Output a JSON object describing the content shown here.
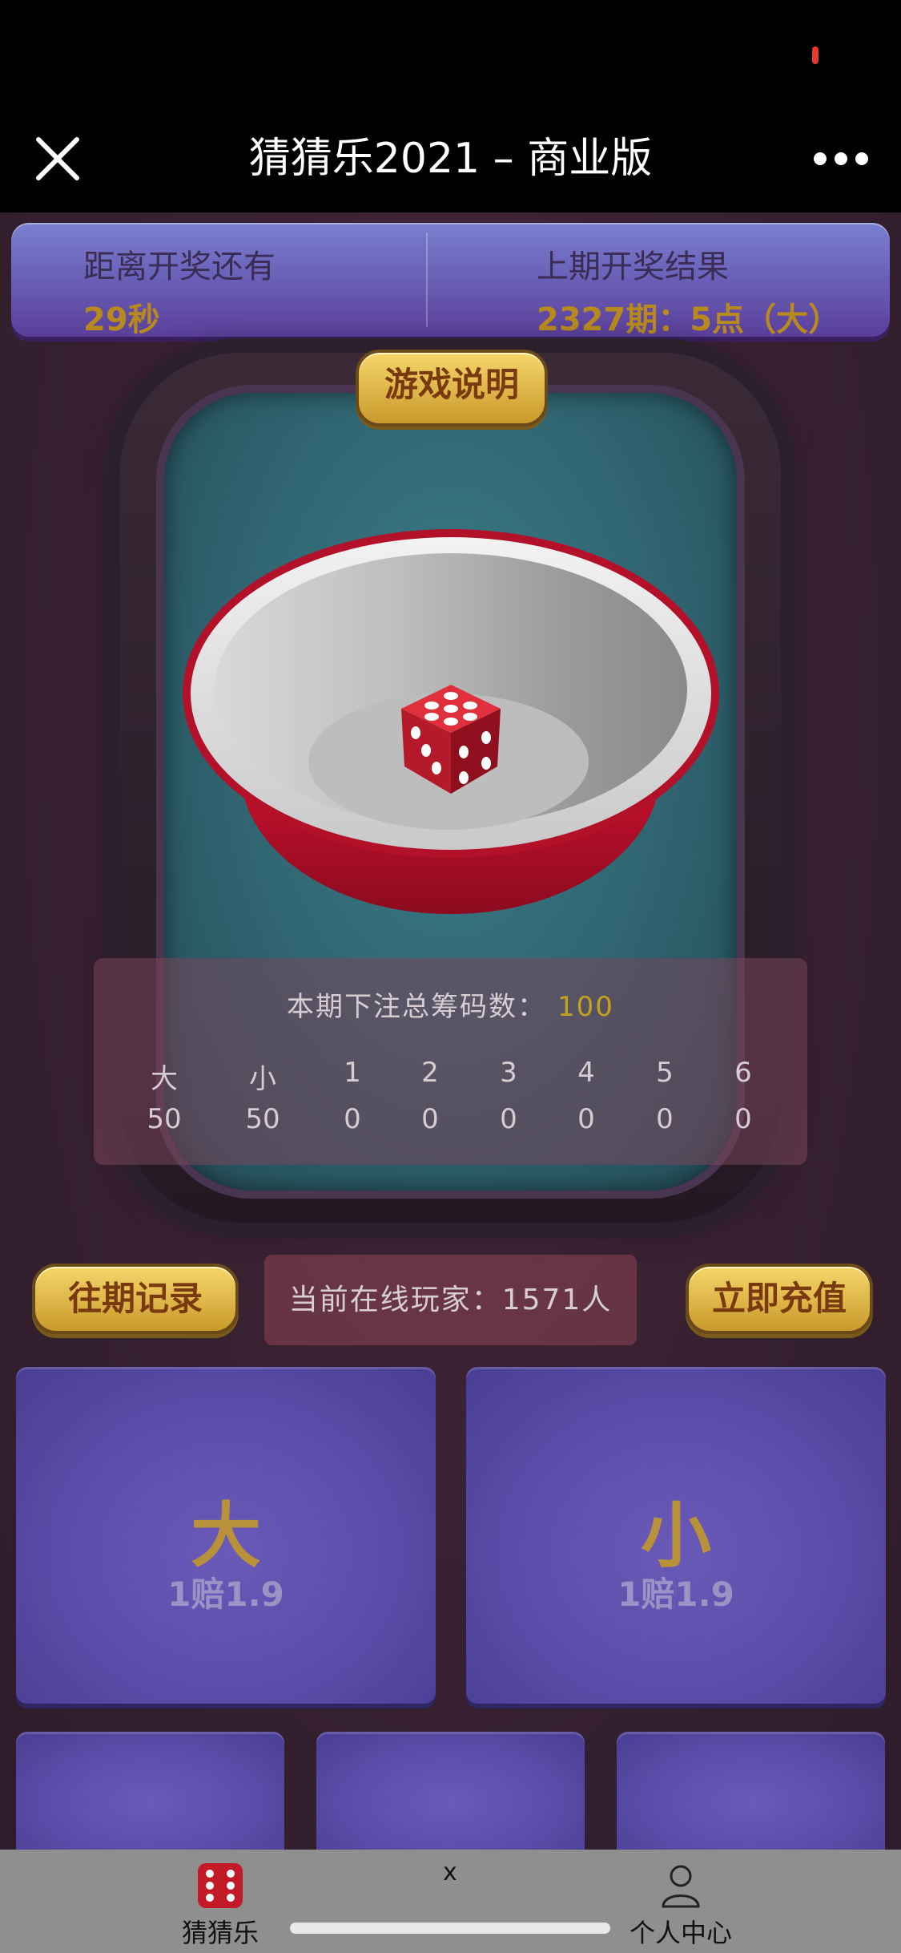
{
  "nav": {
    "title": "猜猜乐2021 – 商业版"
  },
  "info": {
    "countdown_label": "距离开奖还有",
    "countdown_value": "29秒",
    "last_label": "上期开奖结果",
    "last_value": "2327期：5点（大）"
  },
  "board": {
    "rules_button": "游戏说明"
  },
  "stats": {
    "title": "本期下注总筹码数：",
    "total": "100",
    "headers": [
      "大",
      "小",
      "1",
      "2",
      "3",
      "4",
      "5",
      "6"
    ],
    "values": [
      "50",
      "50",
      "0",
      "0",
      "0",
      "0",
      "0",
      "0"
    ]
  },
  "actions": {
    "history": "往期记录",
    "online": "当前在线玩家：1571人",
    "recharge": "立即充值"
  },
  "bets": [
    {
      "label": "大",
      "odds": "1赔1.9"
    },
    {
      "label": "小",
      "odds": "1赔1.9"
    }
  ],
  "tabbar": {
    "close": "x",
    "tabs": [
      {
        "label": "猜猜乐",
        "icon": "dice-icon"
      },
      {
        "label": "个人中心",
        "icon": "person-icon"
      }
    ]
  },
  "colors": {
    "accent_gold": "#b88a1e",
    "die_red": "#c8102e",
    "bet_purple": "#5a4ca8"
  }
}
